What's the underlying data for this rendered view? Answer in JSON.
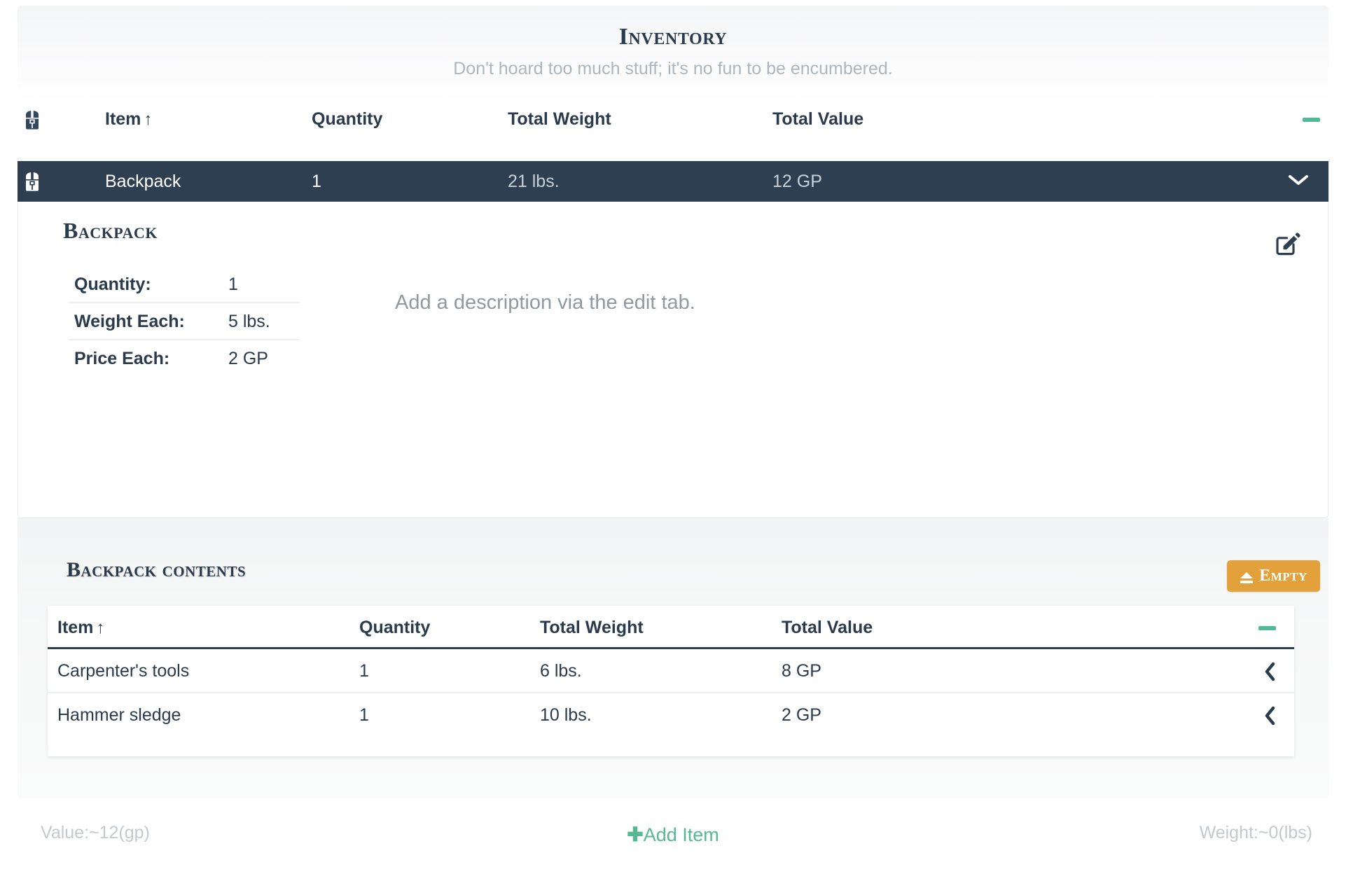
{
  "header": {
    "title": "Inventory",
    "subtitle": "Don't hoard too much stuff; it's no fun to be encumbered."
  },
  "colors": {
    "accent_green": "#4fba93",
    "dark_navy": "#2e3f52",
    "orange": "#e3a13c",
    "muted_gray": "#aeb6bd"
  },
  "main_table": {
    "columns": {
      "icon": "backpack-icon",
      "item": "Item",
      "item_sort": "↑",
      "quantity": "Quantity",
      "total_weight": "Total Weight",
      "total_value": "Total Value",
      "collapse_all": "—"
    },
    "rows": [
      {
        "icon": "backpack-icon",
        "item": "Backpack",
        "quantity": "1",
        "total_weight": "21 lbs.",
        "total_value": "12 GP",
        "expand_toggle": "⌄",
        "selected": true
      }
    ]
  },
  "detail": {
    "title": "Backpack",
    "edit_icon": "edit-pencil-icon",
    "attributes": [
      {
        "label": "Quantity:",
        "value": "1"
      },
      {
        "label": "Weight Each:",
        "value": "5 lbs."
      },
      {
        "label": "Price Each:",
        "value": "2 GP"
      }
    ],
    "description_placeholder": "Add a description via the edit tab."
  },
  "contents": {
    "title": "Backpack contents",
    "empty_button": {
      "label": "Empty",
      "icon": "eject-icon"
    },
    "columns": {
      "item": "Item",
      "item_sort": "↑",
      "quantity": "Quantity",
      "total_weight": "Total Weight",
      "total_value": "Total Value",
      "collapse_all": "—"
    },
    "rows": [
      {
        "item": "Carpenter's tools",
        "quantity": "1",
        "total_weight": "6 lbs.",
        "total_value": "8 GP",
        "move_out": "‹"
      },
      {
        "item": "Hammer sledge",
        "quantity": "1",
        "total_weight": "10 lbs.",
        "total_value": "2 GP",
        "move_out": "‹"
      }
    ]
  },
  "footer": {
    "value_total": "Value:~12(gp)",
    "add_item": "Add Item",
    "add_item_icon": "plus-icon",
    "weight_total": "Weight:~0(lbs)"
  }
}
